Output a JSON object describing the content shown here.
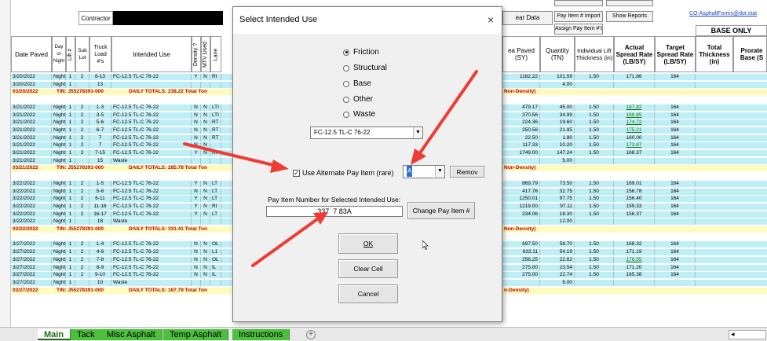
{
  "toolbar": {
    "contractor_label": "Contractor",
    "clear_data": "ear Data",
    "btn_row1_a": "",
    "btn_row1_b": "",
    "pay_item_import": "Pay Item # Import",
    "show_reports": "Show Reports",
    "assign_pay_item": "Assign Pay Item #'s",
    "email_link": "CO-AsphaltForms@dot.stat",
    "base_only": "BASE ONLY"
  },
  "headers": {
    "date_paved": "Date Paved",
    "day_night": "Day or Night",
    "lift": "Lift #",
    "sub_lot": "Sub Lot",
    "truck_load": "Truck Load #'s",
    "intended_use": "Intended Use",
    "density": "Density ?",
    "mtv_used": "MTV Used",
    "lane": "Lane",
    "area_paved": "ea Paved (SY)",
    "quantity": "Quantity (TN)",
    "lift_thickness": "Individual Lift Thickness (in)",
    "actual_rate": "Actual Spread Rate (LB/SY)",
    "target_rate": "Target Spread Rate (LB/SY)",
    "total_thickness": "Total Thickness (in)",
    "prorated": "Prorate Base (S"
  },
  "rows": [
    {
      "type": "data",
      "date": "3/20/2022",
      "dn": "Night",
      "lift": "1",
      "lot": "2",
      "truck": "8-13",
      "use": "FC-12.5 TL-C 76-22",
      "dens": "Y",
      "mtv": "N",
      "lane": "RI",
      "area": "1182.22",
      "qty": "101.59",
      "thick": "1.50",
      "actual": "171.86",
      "target": "164",
      "grn": false
    },
    {
      "type": "data",
      "date": "3/20/2022",
      "dn": "Night",
      "lift": "1",
      "lot": "",
      "truck": "13",
      "use": "",
      "dens": "",
      "mtv": "",
      "lane": "",
      "area": "",
      "qty": "4.00",
      "thick": "",
      "actual": "",
      "target": "",
      "grn": false
    },
    {
      "type": "total",
      "date": "03/20/2022",
      "tin": "TIN: J55278391-000",
      "totals": "DAILY TOTALS:  238.22 Total Ton",
      "area": "Non-Density)"
    },
    {
      "type": "blank"
    },
    {
      "type": "data",
      "date": "3/21/2022",
      "dn": "Night",
      "lift": "1",
      "lot": "2",
      "truck": "1-3",
      "use": "FC-12.5 TL-C 76-22",
      "dens": "N",
      "mtv": "N",
      "lane": "LTI",
      "area": "479.17",
      "qty": "45.00",
      "thick": "1.50",
      "actual": "187.82",
      "target": "164",
      "grn": true
    },
    {
      "type": "data",
      "date": "3/21/2022",
      "dn": "Night",
      "lift": "1",
      "lot": "2",
      "truck": "3-5",
      "use": "FC-12.5 TL-C 76-22",
      "dens": "N",
      "mtv": "N",
      "lane": "LTI",
      "area": "370.56",
      "qty": "34.99",
      "thick": "1.50",
      "actual": "188.85",
      "target": "164",
      "grn": true
    },
    {
      "type": "data",
      "date": "3/21/2022",
      "dn": "Night",
      "lift": "1",
      "lot": "2",
      "truck": "5-6",
      "use": "FC-12.5 TL-C 76-22",
      "dens": "N",
      "mtv": "N",
      "lane": "RT",
      "area": "224.36",
      "qty": "19.60",
      "thick": "1.50",
      "actual": "174.72",
      "target": "164",
      "grn": true
    },
    {
      "type": "data",
      "date": "3/21/2022",
      "dn": "Night",
      "lift": "1",
      "lot": "2",
      "truck": "6-7",
      "use": "FC-12.5 TL-C 76-22",
      "dens": "N",
      "mtv": "N",
      "lane": "RT",
      "area": "250.56",
      "qty": "21.95",
      "thick": "1.50",
      "actual": "175.21",
      "target": "164",
      "grn": true
    },
    {
      "type": "data",
      "date": "3/21/2022",
      "dn": "Night",
      "lift": "1",
      "lot": "2",
      "truck": "7",
      "use": "FC-12.5 TL-C 76-22",
      "dens": "N",
      "mtv": "N",
      "lane": "RT",
      "area": "22.50",
      "qty": "1.80",
      "thick": "1.50",
      "actual": "160.00",
      "target": "164",
      "grn": false
    },
    {
      "type": "data",
      "date": "3/21/2022",
      "dn": "Night",
      "lift": "1",
      "lot": "2",
      "truck": "7",
      "use": "FC-12.5 TL-C 76-22",
      "dens": "N",
      "mtv": "N",
      "lane": "",
      "area": "117.33",
      "qty": "10.20",
      "thick": "1.50",
      "actual": "173.87",
      "target": "164",
      "grn": true
    },
    {
      "type": "data",
      "date": "3/21/2022",
      "dn": "Night",
      "lift": "1",
      "lot": "2",
      "truck": "7-15",
      "use": "FC-12.5 TL-C 76-22",
      "dens": "Y",
      "mtv": "N",
      "lane": "RI",
      "area": "1749.00",
      "qty": "147.24",
      "thick": "1.50",
      "actual": "168.37",
      "target": "164",
      "grn": false
    },
    {
      "type": "data",
      "date": "3/21/2022",
      "dn": "Night",
      "lift": "1",
      "lot": "",
      "truck": "15",
      "use": "Waste",
      "dens": "",
      "mtv": "",
      "lane": "",
      "area": "",
      "qty": "5.00",
      "thick": "",
      "actual": "",
      "target": "",
      "grn": false
    },
    {
      "type": "total",
      "date": "03/21/2022",
      "tin": "TIN: J55278391-000",
      "totals": "DAILY TOTALS:  285.78 Total Ton",
      "area": "Non-Density)"
    },
    {
      "type": "blank"
    },
    {
      "type": "data",
      "date": "3/22/2022",
      "dn": "Night",
      "lift": "1",
      "lot": "2",
      "truck": "1-5",
      "use": "FC-12.5 TL-C 76-22",
      "dens": "Y",
      "mtv": "N",
      "lane": "LT",
      "area": "869.79",
      "qty": "73.50",
      "thick": "1.50",
      "actual": "169.01",
      "target": "164",
      "grn": false
    },
    {
      "type": "data",
      "date": "3/22/2022",
      "dn": "Night",
      "lift": "1",
      "lot": "2",
      "truck": "5-6",
      "use": "FC-12.5 TL-C 76-22",
      "dens": "N",
      "mtv": "N",
      "lane": "LT",
      "area": "417.76",
      "qty": "32.75",
      "thick": "1.50",
      "actual": "156.78",
      "target": "164",
      "grn": false
    },
    {
      "type": "data",
      "date": "3/22/2022",
      "dn": "Night",
      "lift": "1",
      "lot": "2",
      "truck": "6-11",
      "use": "FC-12.5 TL-C 76-22",
      "dens": "Y",
      "mtv": "N",
      "lane": "LT",
      "area": "1250.01",
      "qty": "97.75",
      "thick": "1.50",
      "actual": "156.40",
      "target": "164",
      "grn": false
    },
    {
      "type": "data",
      "date": "3/22/2022",
      "dn": "Night",
      "lift": "1",
      "lot": "2",
      "truck": "11-16",
      "use": "FC-12.5 TL-C 76-22",
      "dens": "Y",
      "mtv": "N",
      "lane": "RI",
      "area": "1219.00",
      "qty": "97.11",
      "thick": "1.50",
      "actual": "159.33",
      "target": "164",
      "grn": false
    },
    {
      "type": "data",
      "date": "3/22/2022",
      "dn": "Night",
      "lift": "1",
      "lot": "2",
      "truck": "16-17",
      "use": "FC-12.5 TL-C 76-22",
      "dens": "Y",
      "mtv": "N",
      "lane": "LT",
      "area": "234.06",
      "qty": "18.30",
      "thick": "1.50",
      "actual": "156.37",
      "target": "164",
      "grn": false
    },
    {
      "type": "data",
      "date": "3/22/2022",
      "dn": "Night",
      "lift": "1",
      "lot": "",
      "truck": "18",
      "use": "Waste",
      "dens": "",
      "mtv": "",
      "lane": "",
      "area": "",
      "qty": "12.00",
      "thick": "",
      "actual": "",
      "target": "",
      "grn": false
    },
    {
      "type": "total",
      "date": "03/22/2022",
      "tin": "TIN: J55278391-000",
      "totals": "DAILY TOTALS:  331.41 Total Ton",
      "area": "Non-Density)"
    },
    {
      "type": "blank"
    },
    {
      "type": "data",
      "date": "3/27/2022",
      "dn": "Night",
      "lift": "1",
      "lot": "2",
      "truck": "1-4",
      "use": "FC-12.5 TL-C 76-22",
      "dens": "N",
      "mtv": "N",
      "lane": "OL",
      "area": "697.50",
      "qty": "58.70",
      "thick": "1.50",
      "actual": "168.32",
      "target": "164",
      "grn": false
    },
    {
      "type": "data",
      "date": "3/27/2022",
      "dn": "Night",
      "lift": "1",
      "lot": "2",
      "truck": "4-6",
      "use": "FC-12.5 TL-C 76-22",
      "dens": "N",
      "mtv": "N",
      "lane": "L1",
      "area": "633.11",
      "qty": "54.19",
      "thick": "1.50",
      "actual": "171.19",
      "target": "164",
      "grn": false
    },
    {
      "type": "data",
      "date": "3/27/2022",
      "dn": "Night",
      "lift": "1",
      "lot": "2",
      "truck": "7-8",
      "use": "FC-12.5 TL-C 76-22",
      "dens": "N",
      "mtv": "N",
      "lane": "OL",
      "area": "256.25",
      "qty": "22.62",
      "thick": "1.50",
      "actual": "176.55",
      "target": "164",
      "grn": true
    },
    {
      "type": "data",
      "date": "3/27/2022",
      "dn": "Night",
      "lift": "1",
      "lot": "2",
      "truck": "8-9",
      "use": "FC-12.5 TL-C 76-22",
      "dens": "N",
      "mtv": "N",
      "lane": "IL",
      "area": "275.00",
      "qty": "23.54",
      "thick": "1.50",
      "actual": "171.20",
      "target": "164",
      "grn": false
    },
    {
      "type": "data",
      "date": "3/27/2022",
      "dn": "Night",
      "lift": "1",
      "lot": "2",
      "truck": "9-10",
      "use": "FC-12.5 TL-C 76-22",
      "dens": "N",
      "mtv": "N",
      "lane": "IL",
      "area": "275.00",
      "qty": "22.74",
      "thick": "1.50",
      "actual": "165.38",
      "target": "164",
      "grn": false
    },
    {
      "type": "data",
      "date": "3/27/2022",
      "dn": "Night",
      "lift": "1",
      "lot": "",
      "truck": "10",
      "use": "Waste",
      "dens": "",
      "mtv": "",
      "lane": "",
      "area": "",
      "qty": "6.00",
      "thick": "",
      "actual": "",
      "target": "",
      "grn": false
    },
    {
      "type": "total",
      "date": "03/27/2022",
      "tin": "TIN: J55278391-000",
      "totals": "DAILY TOTALS:  187.79 Total Ton",
      "area": "n-Density)"
    }
  ],
  "tabs": [
    "Main",
    "Tack",
    "Misc Asphalt",
    "Temp Asphalt",
    "Instructions"
  ],
  "tab_plus": "+",
  "dialog": {
    "title": "Select Intended Use",
    "close": "×",
    "radios": [
      {
        "label": "Friction",
        "checked": true
      },
      {
        "label": "Structural",
        "checked": false
      },
      {
        "label": "Base",
        "checked": false
      },
      {
        "label": "Other",
        "checked": false
      },
      {
        "label": "Waste",
        "checked": false
      }
    ],
    "intended_use_value": "FC-12.5 TL-C 76-22",
    "alt_pay_label": "Use Alternate Pay Item (rare)",
    "alt_pay_checked": "✓",
    "alt_value": "A",
    "remove": "Remov",
    "pay_item_label": "Pay Item Number for Selected Intended Use:",
    "pay_item_value": "337  7 83A",
    "change_pay_item": "Change Pay Item #",
    "ok": "OK",
    "clear_cell": "Clear Cell",
    "cancel": "Cancel"
  },
  "colors": {
    "arrow": "#ee3b33",
    "data_row": "#bfeef6",
    "total_row": "#fffbbd",
    "tab_green": "#4cbf3c"
  }
}
